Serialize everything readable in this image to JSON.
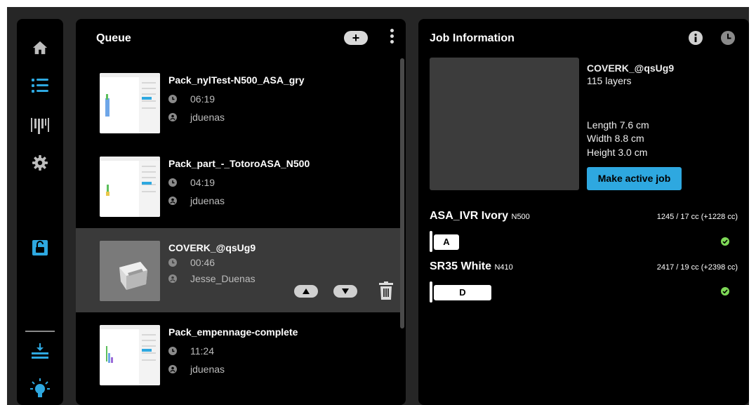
{
  "colors": {
    "accent": "#2ea8e0",
    "background": "#262626",
    "panel": "#000000",
    "selected_row": "#3a3a3a",
    "ok": "#7ed957"
  },
  "sidebar": {
    "items": [
      {
        "name": "home",
        "icon": "home-icon",
        "active": false
      },
      {
        "name": "queue",
        "icon": "list-icon",
        "active": true
      },
      {
        "name": "materials",
        "icon": "material-bays-icon",
        "active": false
      },
      {
        "name": "settings",
        "icon": "gear-icon",
        "active": false
      },
      {
        "name": "unlock",
        "icon": "unlock-icon",
        "active": true
      },
      {
        "name": "download",
        "icon": "download-icon",
        "active": true
      },
      {
        "name": "light",
        "icon": "lightbulb-icon",
        "active": true
      }
    ]
  },
  "queue": {
    "title": "Queue",
    "add_label": "+",
    "items": [
      {
        "name": "Pack_nylTest-N500_ASA_gry",
        "time": "06:19",
        "user": "jduenas",
        "selected": false
      },
      {
        "name": "Pack_part_-_TotoroASA_N500",
        "time": "04:19",
        "user": "jduenas",
        "selected": false
      },
      {
        "name": "COVERK_@qsUg9",
        "time": "00:46",
        "user": "Jesse_Duenas",
        "selected": true
      },
      {
        "name": "Pack_empennage-complete",
        "time": "11:24",
        "user": "jduenas",
        "selected": false
      }
    ]
  },
  "job": {
    "title": "Job Information",
    "name": "COVERK_@qsUg9",
    "layers": "115 layers",
    "length": "Length 7.6 cm",
    "width": "Width 8.8 cm",
    "height": "Height 3.0 cm",
    "make_active_label": "Make active job",
    "materials": [
      {
        "name": "ASA_IVR Ivory",
        "printer": "N500",
        "volume": "1245 / 17 cc (+1228 cc)",
        "slot": "A"
      },
      {
        "name": "SR35 White",
        "printer": "N410",
        "volume": "2417 / 19 cc (+2398 cc)",
        "slot": "D"
      }
    ]
  }
}
